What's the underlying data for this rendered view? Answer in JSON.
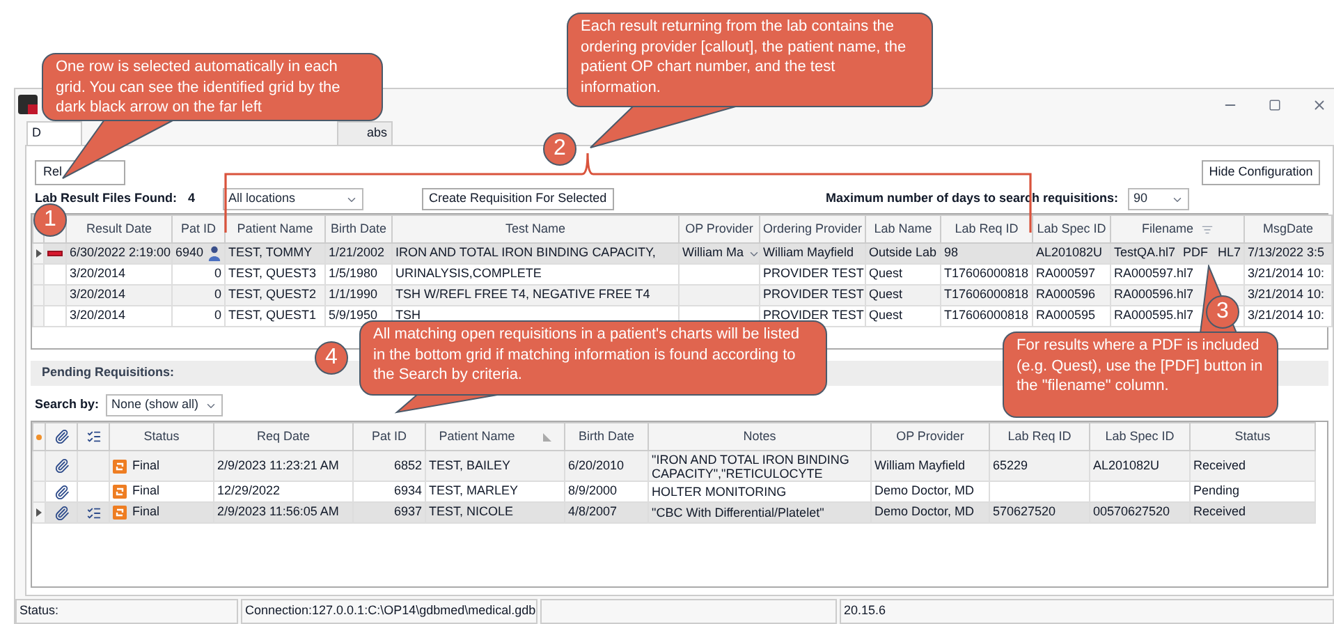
{
  "window": {
    "tabs": [
      {
        "label": "D",
        "selected": true
      },
      {
        "label": "abs",
        "selected": false
      }
    ]
  },
  "toolbar": {
    "left_button": "Rel",
    "hide_configuration_button": "Hide Configuration"
  },
  "lab_results": {
    "found_label": "Lab Result Files Found:",
    "found_count": "4",
    "location_dropdown": "All locations",
    "create_button": "Create Requisition For Selected",
    "max_days_label": "Maximum number of days to search requisitions:",
    "max_days_value": "90",
    "columns": [
      "Result Date",
      "Pat ID",
      "Patient Name",
      "Birth Date",
      "Test Name",
      "OP Provider",
      "Ordering Provider",
      "Lab Name",
      "Lab Req ID",
      "Lab Spec ID",
      "Filename",
      "MsgDate"
    ],
    "rows": [
      {
        "selected": true,
        "flagged": true,
        "patient_icon": true,
        "result_date": "6/30/2022 2:19:00",
        "pat_id": "6940",
        "patient_name": "TEST, TOMMY",
        "birth_date": "1/21/2002",
        "test_name": "IRON AND TOTAL IRON BINDING CAPACITY,",
        "op_provider": "William Ma",
        "ordering_provider": "William Mayfield",
        "lab_name": "Outside Lab",
        "lab_req_id": "98",
        "lab_spec_id": "AL201082U",
        "filename": "TestQA.hl7",
        "pdf_button": "PDF",
        "hl7_button": "HL7",
        "msg_date": "7/13/2022 3:5"
      },
      {
        "selected": false,
        "flagged": false,
        "patient_icon": false,
        "result_date": "3/20/2014",
        "pat_id": "0",
        "patient_name": "TEST, QUEST3",
        "birth_date": "1/5/1980",
        "test_name": "URINALYSIS,COMPLETE",
        "ordering_provider": "PROVIDER TEST",
        "lab_name": "Quest",
        "lab_req_id": "T17606000818",
        "lab_spec_id": "RA000597",
        "filename": "RA000597.hl7",
        "msg_date": "3/21/2014 10:"
      },
      {
        "selected": false,
        "flagged": false,
        "patient_icon": false,
        "result_date": "3/20/2014",
        "pat_id": "0",
        "patient_name": "TEST, QUEST2",
        "birth_date": "1/1/1990",
        "test_name": "TSH W/REFL FREE T4, NEGATIVE FREE T4",
        "ordering_provider": "PROVIDER TEST",
        "lab_name": "Quest",
        "lab_req_id": "T17606000818",
        "lab_spec_id": "RA000596",
        "filename": "RA000596.hl7",
        "msg_date": "3/21/2014 10:"
      },
      {
        "selected": false,
        "flagged": false,
        "patient_icon": false,
        "result_date": "3/20/2014",
        "pat_id": "0",
        "patient_name": "TEST, QUEST1",
        "birth_date": "5/9/1950",
        "test_name": "TSH",
        "ordering_provider": "PROVIDER TEST",
        "lab_name": "Quest",
        "lab_req_id": "T17606000818",
        "lab_spec_id": "RA000595",
        "filename": "RA000595.hl7",
        "msg_date": "3/21/2014 10:"
      }
    ]
  },
  "pending_requisitions": {
    "title": "Pending Requisitions:",
    "search_label": "Search by:",
    "search_value": "None (show all)",
    "columns": [
      "Status",
      "Req Date",
      "Pat ID",
      "Patient Name",
      "Birth Date",
      "Notes",
      "OP Provider",
      "Lab Req ID",
      "Lab Spec ID",
      "Status"
    ],
    "rows": [
      {
        "selected": false,
        "attachment": true,
        "checklist": false,
        "status": "Final",
        "req_date": "2/9/2023 11:23:21 AM",
        "pat_id": "6852",
        "patient_name": "TEST, BAILEY",
        "birth_date": "6/20/2010",
        "notes": "\"IRON AND TOTAL IRON BINDING CAPACITY\",\"RETICULOCYTE",
        "op_provider": "William Mayfield",
        "lab_req_id": "65229",
        "lab_spec_id": "AL201082U",
        "req_status": "Received"
      },
      {
        "selected": false,
        "attachment": true,
        "checklist": false,
        "status": "Final",
        "req_date": "12/29/2022",
        "pat_id": "6934",
        "patient_name": "TEST, MARLEY",
        "birth_date": "8/9/2000",
        "notes": "HOLTER MONITORING",
        "op_provider": "Demo Doctor, MD",
        "req_status": "Pending"
      },
      {
        "selected": true,
        "attachment": true,
        "checklist": true,
        "status": "Final",
        "req_date": "2/9/2023 11:56:05 AM",
        "pat_id": "6937",
        "patient_name": "TEST, NICOLE",
        "birth_date": "4/8/2007",
        "notes": "\"CBC With Differential/Platelet\"",
        "op_provider": "Demo Doctor, MD",
        "lab_req_id": "570627520",
        "lab_spec_id": "00570627520",
        "req_status": "Received"
      }
    ]
  },
  "status_bar": {
    "status_label": "Status:",
    "connection": "Connection:127.0.0.1:C:\\OP14\\gdbmed\\medical.gdb",
    "version": "20.15.6"
  },
  "callouts": [
    {
      "number": "1",
      "text": "One row is selected automatically in each grid.  You can see the identified grid by the dark black arrow on the far left"
    },
    {
      "number": "2",
      "text": "Each result returning from the lab contains the ordering provider [callout], the patient name, the patient OP chart number, and the test information."
    },
    {
      "number": "3",
      "text": "For results where a PDF is included (e.g. Quest), use the [PDF] button in the \"filename\" column."
    },
    {
      "number": "4",
      "text": "All matching open requisitions in a patient's charts will be listed in the bottom grid if matching information is found according to the Search by criteria."
    }
  ]
}
